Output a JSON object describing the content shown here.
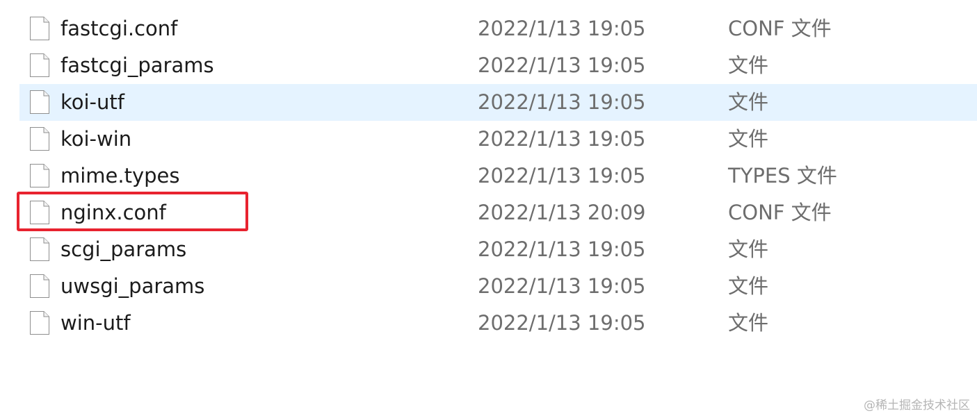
{
  "files": [
    {
      "name": "fastcgi.conf",
      "date": "2022/1/13 19:05",
      "type": "CONF 文件",
      "hovered": false
    },
    {
      "name": "fastcgi_params",
      "date": "2022/1/13 19:05",
      "type": "文件",
      "hovered": false
    },
    {
      "name": "koi-utf",
      "date": "2022/1/13 19:05",
      "type": "文件",
      "hovered": true
    },
    {
      "name": "koi-win",
      "date": "2022/1/13 19:05",
      "type": "文件",
      "hovered": false
    },
    {
      "name": "mime.types",
      "date": "2022/1/13 19:05",
      "type": "TYPES 文件",
      "hovered": false
    },
    {
      "name": "nginx.conf",
      "date": "2022/1/13 20:09",
      "type": "CONF 文件",
      "hovered": false,
      "highlighted": true
    },
    {
      "name": "scgi_params",
      "date": "2022/1/13 19:05",
      "type": "文件",
      "hovered": false
    },
    {
      "name": "uwsgi_params",
      "date": "2022/1/13 19:05",
      "type": "文件",
      "hovered": false
    },
    {
      "name": "win-utf",
      "date": "2022/1/13 19:05",
      "type": "文件",
      "hovered": false
    }
  ],
  "icon": "file-icon",
  "colors": {
    "hover_row": "#e5f3ff",
    "highlight_border": "#e8232f"
  },
  "watermark": "@稀土掘金技术社区"
}
